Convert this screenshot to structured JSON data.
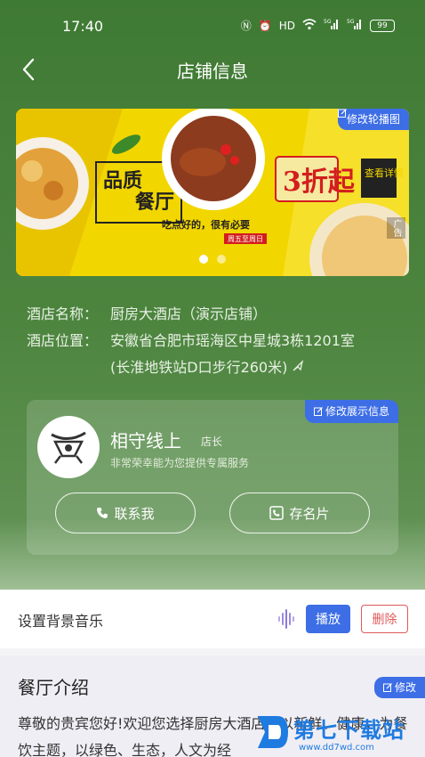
{
  "status_bar": {
    "time": "17:40",
    "network": "5G",
    "battery": "99"
  },
  "nav": {
    "title": "店铺信息"
  },
  "banner": {
    "edit_label": "修改轮播图",
    "ad_label": "广告",
    "slogan_left": [
      "品质",
      "餐厅"
    ],
    "discount": "3折起",
    "detail": "查看详情",
    "tagline": "吃点好的，很有必要",
    "subtag": "周五至周日",
    "dots": 2,
    "active_dot": 0
  },
  "info": {
    "name_key": "酒店名称：",
    "name_val": "厨房大酒店（演示店铺）",
    "addr_key": "酒店位置：",
    "addr_line1": "安徽省合肥市瑶海区中星城3栋1201室",
    "addr_line2": "(长淮地铁站D口步行260米)"
  },
  "manager": {
    "edit_label": "修改展示信息",
    "name": "相守线上",
    "role": "店长",
    "desc": "非常荣幸能为您提供专属服务",
    "contact_label": "联系我",
    "save_card_label": "存名片"
  },
  "music": {
    "label": "设置背景音乐",
    "play_label": "播放",
    "delete_label": "删除"
  },
  "intro": {
    "title": "餐厅介绍",
    "edit_label": "修改",
    "text": "尊敬的贵宾您好!欢迎您选择厨房大酒店，以新鲜、健康，为餐饮主题，以绿色、生态，人文为经"
  },
  "watermark": {
    "title": "第七下载站",
    "url": "www.dd7wd.com"
  },
  "colors": {
    "accent": "#3d6ee6",
    "header_green": "#4d853f",
    "delete_red": "#e05a5a"
  }
}
